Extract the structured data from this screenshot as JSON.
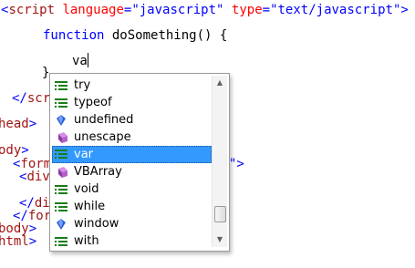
{
  "editor": {
    "line1": {
      "open": "<",
      "tag": "script",
      "attr1_name": "language",
      "attr1_eq": "=",
      "attr1_val": "\"javascript\"",
      "attr2_name": "type",
      "attr2_eq": "=",
      "attr2_val": "\"text/javascript\"",
      "close": ">"
    },
    "line2": {
      "keyword": "function",
      "rest": "doSomething() {"
    },
    "line3": {
      "typed": "va"
    },
    "line4": {
      "text": "}"
    },
    "line5": {
      "open": "</",
      "tag": "scr"
    },
    "line6": {
      "tag": "head",
      "close": ">"
    },
    "line8": {
      "tag": "ody",
      "close": ">"
    },
    "line9": {
      "open": "<",
      "tag": "form",
      "tail": "\">"
    },
    "line10": {
      "open": "<",
      "tag": "div"
    },
    "line12": {
      "open": "</",
      "tag": "div"
    },
    "line13": {
      "open": "</",
      "tag": "for"
    },
    "line14": {
      "tag": "body",
      "close": ">"
    },
    "line15": {
      "tag": "html",
      "close": ">"
    }
  },
  "completion": {
    "items": [
      {
        "label": "try",
        "icon": "keyword-icon"
      },
      {
        "label": "typeof",
        "icon": "keyword-icon"
      },
      {
        "label": "undefined",
        "icon": "object-icon"
      },
      {
        "label": "unescape",
        "icon": "method-icon"
      },
      {
        "label": "var",
        "icon": "keyword-icon",
        "selected": true
      },
      {
        "label": "VBArray",
        "icon": "method-icon"
      },
      {
        "label": "void",
        "icon": "keyword-icon"
      },
      {
        "label": "while",
        "icon": "keyword-icon"
      },
      {
        "label": "window",
        "icon": "object-icon"
      },
      {
        "label": "with",
        "icon": "keyword-icon"
      }
    ],
    "scroll_position": 0.92
  },
  "colors": {
    "keyword_blue": "#0000ff",
    "tag_maroon": "#a31515",
    "attr_red": "#ff0000",
    "selection": "#3399ff"
  }
}
